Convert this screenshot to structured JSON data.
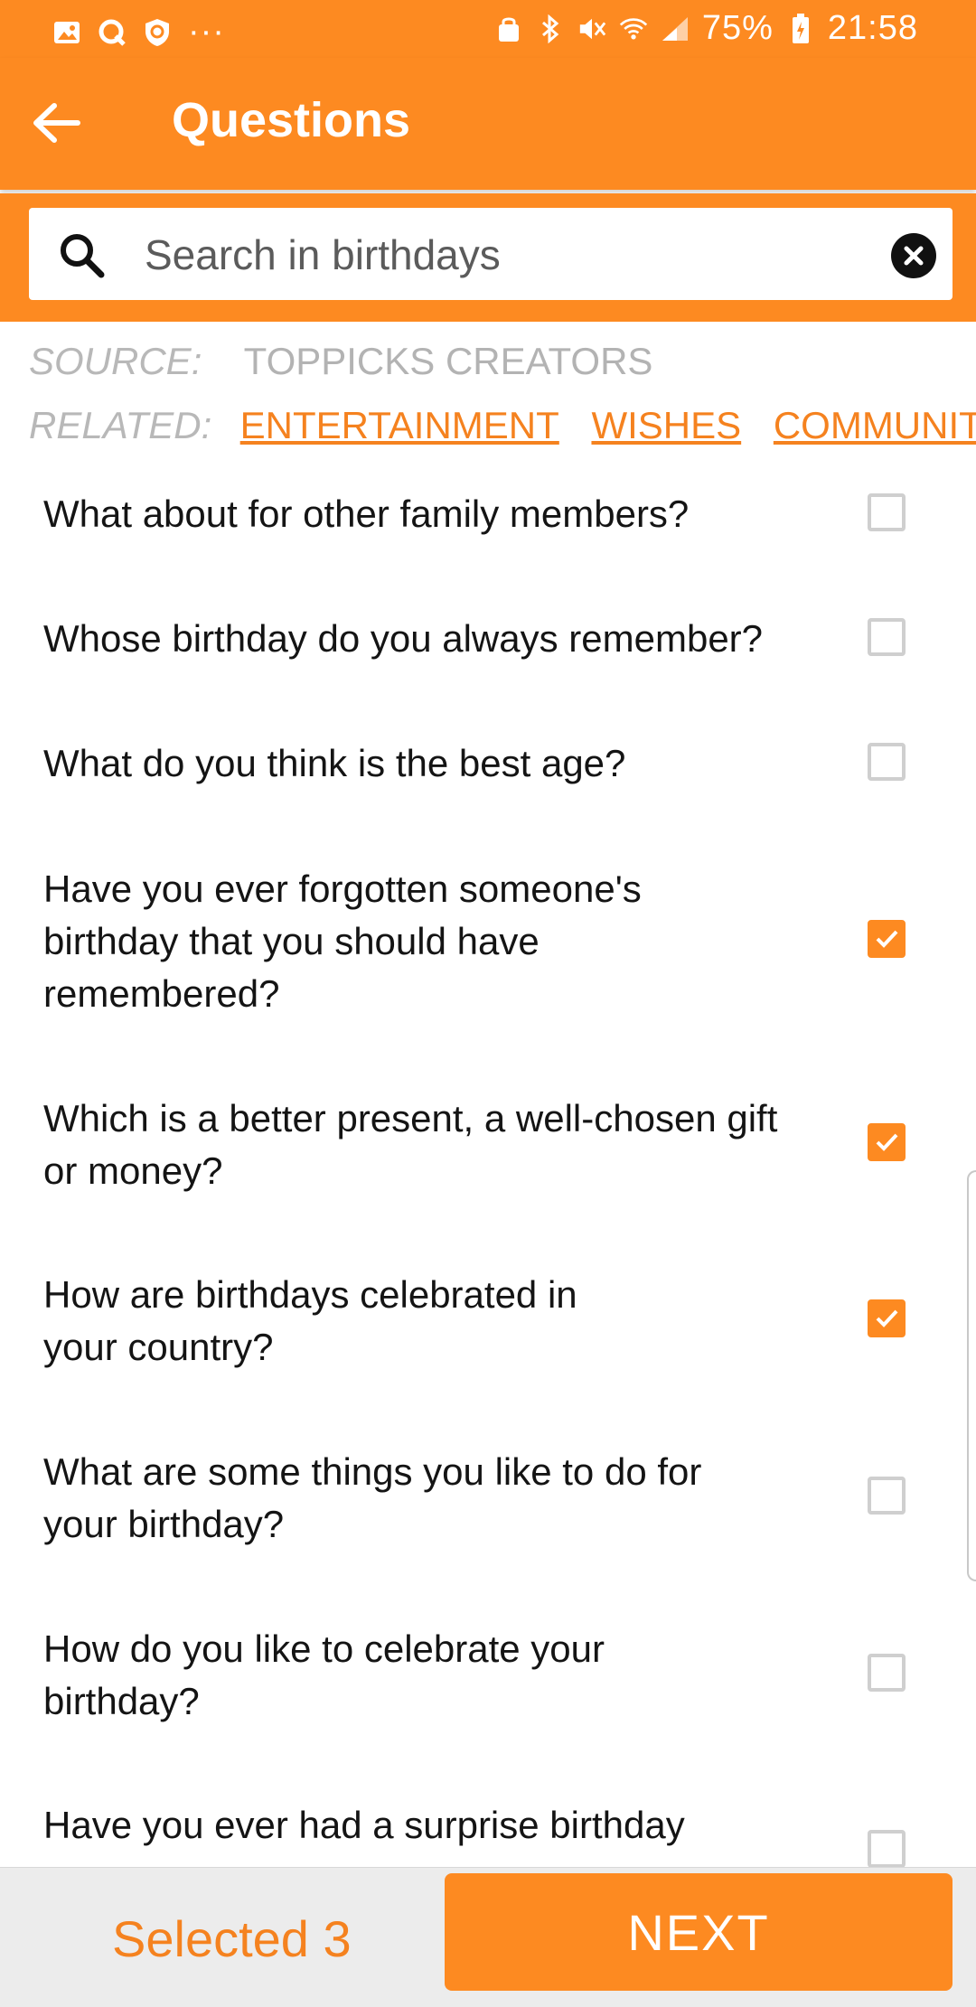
{
  "status_bar": {
    "battery_percent": "75%",
    "time": "21:58",
    "dots": "···"
  },
  "app_bar": {
    "title": "Questions"
  },
  "search": {
    "placeholder": "Search in birthdays"
  },
  "meta": {
    "source_label": "SOURCE:",
    "source_value": "TOPPICKS CREATORS",
    "related_label": "RELATED:",
    "related_links": [
      "ENTERTAINMENT",
      "WISHES",
      "COMMUNITY"
    ]
  },
  "questions": [
    {
      "text": "What about for other family members?",
      "checked": false
    },
    {
      "text": "Whose birthday do you always remember?",
      "checked": false
    },
    {
      "text": "What do you think is the best age?",
      "checked": false
    },
    {
      "text": "Have you ever forgotten someone's birthday that you should have remembered?",
      "checked": true
    },
    {
      "text": "Which is a better present, a well-chosen gift or money?",
      "checked": true
    },
    {
      "text": "How are birthdays celebrated in your country?",
      "checked": true
    },
    {
      "text": "What are some things you like to do for your birthday?",
      "checked": false
    },
    {
      "text": "How do you like to celebrate your birthday?",
      "checked": false
    },
    {
      "text": "Have you ever had a surprise birthday",
      "checked": false
    }
  ],
  "bottom_bar": {
    "selected_label": "Selected 3",
    "next_label": "NEXT"
  },
  "colors": {
    "accent": "#fd8a21",
    "link": "#f5821f"
  }
}
